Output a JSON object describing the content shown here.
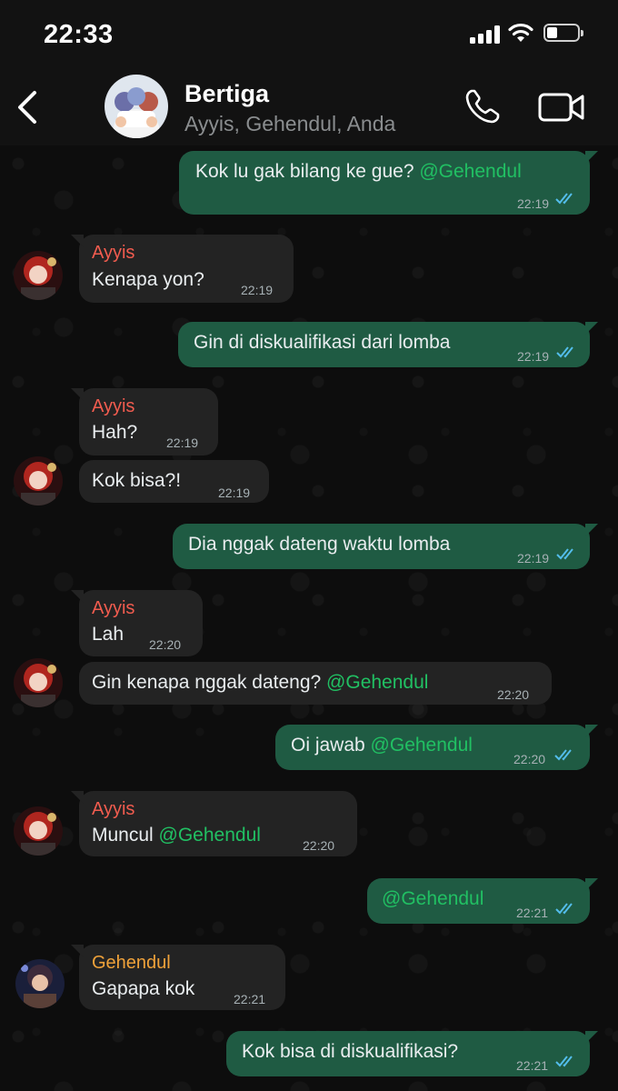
{
  "status_bar": {
    "time": "22:33",
    "battery_level": 0.35,
    "icons": [
      "signal-icon",
      "wifi-icon",
      "battery-icon"
    ]
  },
  "header": {
    "group_name": "Bertiga",
    "members": "Ayyis, Gehendul, Anda",
    "icons": [
      "back-icon",
      "phone-icon",
      "video-icon"
    ]
  },
  "colors": {
    "outgoing_bubble": "#1f5b43",
    "incoming_bubble": "#232323",
    "sender_ayyis": "#f15c4f",
    "sender_gehendul": "#f0a23a",
    "mention": "#21c063",
    "read_ticks": "#53bdeb"
  },
  "messages": [
    {
      "direction": "out",
      "text": "Kok lu gak bilang ke gue? ",
      "mention": "@Gehendul",
      "time": "22:19",
      "status": "read"
    },
    {
      "direction": "in",
      "sender": "Ayyis",
      "text": "Kenapa yon?",
      "time": "22:19"
    },
    {
      "direction": "out",
      "text": "Gin di diskualifikasi dari lomba",
      "time": "22:19",
      "status": "read"
    },
    {
      "direction": "in",
      "sender": "Ayyis",
      "text": "Hah?",
      "time": "22:19"
    },
    {
      "direction": "in",
      "text": "Kok bisa?!",
      "time": "22:19"
    },
    {
      "direction": "out",
      "text": "Dia nggak dateng waktu lomba",
      "time": "22:19",
      "status": "read"
    },
    {
      "direction": "in",
      "sender": "Ayyis",
      "text": "Lah",
      "time": "22:20"
    },
    {
      "direction": "in",
      "text": "Gin kenapa nggak dateng? ",
      "mention": "@Gehendul",
      "time": "22:20"
    },
    {
      "direction": "out",
      "text": "Oi jawab ",
      "mention": "@Gehendul",
      "time": "22:20",
      "status": "read"
    },
    {
      "direction": "in",
      "sender": "Ayyis",
      "text": "Muncul ",
      "mention": "@Gehendul",
      "time": "22:20"
    },
    {
      "direction": "out",
      "text": "",
      "mention": "@Gehendul",
      "time": "22:21",
      "status": "read"
    },
    {
      "direction": "in",
      "sender": "Gehendul",
      "text": "Gapapa kok",
      "time": "22:21"
    },
    {
      "direction": "out",
      "text": "Kok bisa di diskualifikasi?",
      "time": "22:21",
      "status": "read"
    }
  ]
}
